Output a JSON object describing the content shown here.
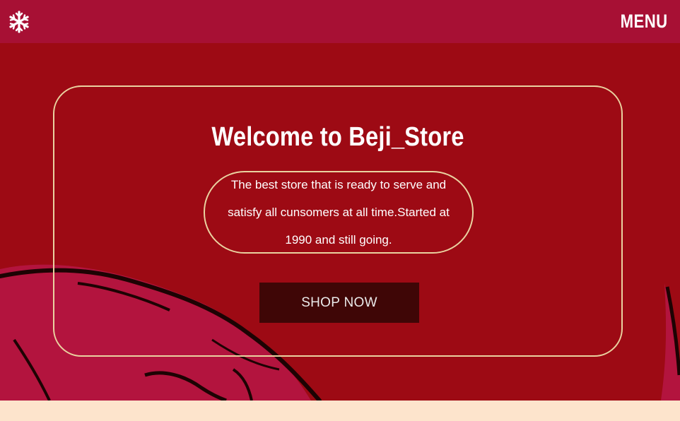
{
  "nav": {
    "logo_icon": "snowflake-icon",
    "menu_label": "MENU"
  },
  "hero": {
    "title": "Welcome to Beji_Store",
    "description": "The best store that is ready to serve and satisfy all cunsomers at all time.Started at 1990 and still going.",
    "cta_label": "SHOP NOW"
  },
  "colors": {
    "navbar": "#a71034",
    "hero_background": "#9d0a14",
    "accent_border": "#ead2a0",
    "cta_background": "#3f0606",
    "footer_strip": "#fde4cc"
  }
}
